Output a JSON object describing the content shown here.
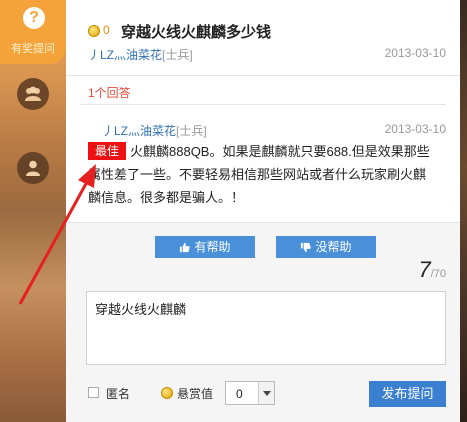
{
  "sidebar": {
    "help_glyph": "?",
    "help_label": "有奖提问",
    "icons": [
      "group-icon",
      "user-icon"
    ]
  },
  "question": {
    "reward": "0",
    "title": "穿越火线火麒麟多少钱",
    "user": "丿LZ灬油菜花",
    "rank": "[士兵]",
    "date": "2013-03-10"
  },
  "answers": {
    "count_label": "1个回答",
    "items": [
      {
        "user": "丿LZ灬油菜花",
        "rank": "[士兵]",
        "date": "2013-03-10",
        "badge": "最佳",
        "text": "火麒麟888QB。如果是麒麟就只要688.但是效果那些属性差了一些。不要轻易相信那些网站或者什么玩家刷火麒麟信息。很多都是骗人。！"
      }
    ]
  },
  "feedback": {
    "helpful": "有帮助",
    "not_helpful": "没帮助"
  },
  "compose": {
    "counter_current": "7",
    "counter_max": "/70",
    "text": "穿越火线火麒麟",
    "anonymous_label": "匿名",
    "reward_label": "悬赏值",
    "reward_value": "0",
    "submit_label": "发布提问"
  },
  "colors": {
    "accent": "#f4a23a",
    "link": "#2f6fb5",
    "best_badge": "#e11111",
    "button": "#4a90d9",
    "annotation_arrow": "#e62020"
  }
}
